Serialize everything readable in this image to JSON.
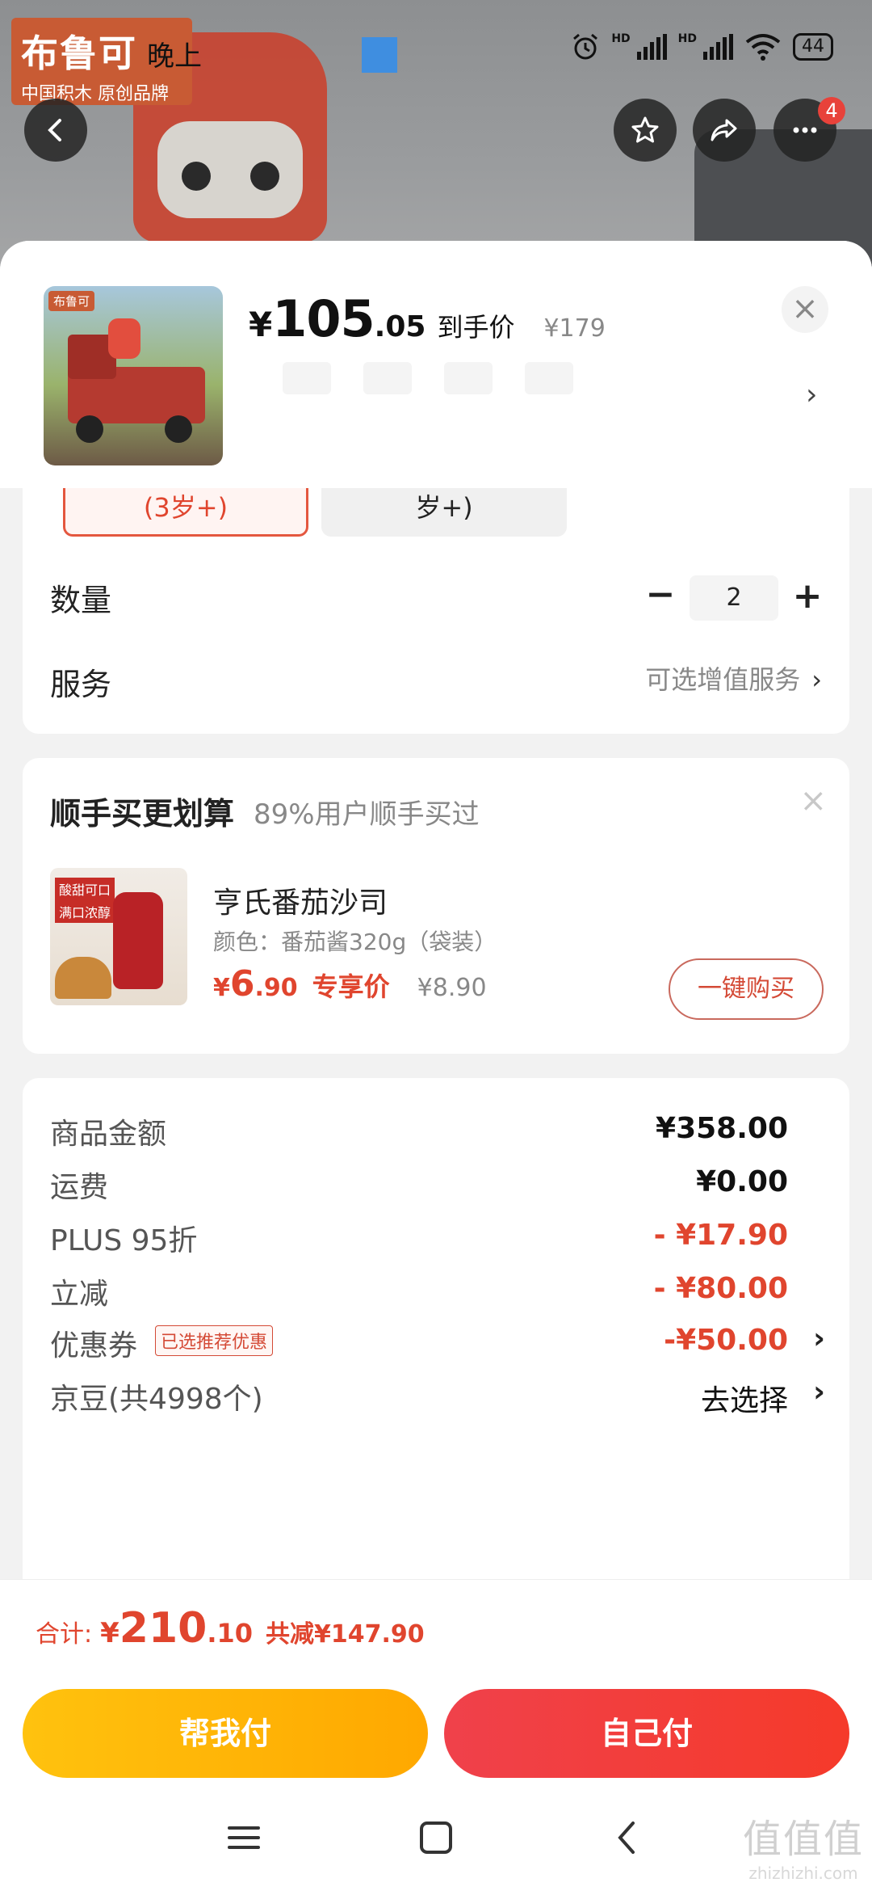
{
  "status_bar": {
    "time": "晚上",
    "battery": "44"
  },
  "backdrop": {
    "logo_big": "布鲁可",
    "logo_small": "中国积木 原创品牌"
  },
  "nav": {
    "badge": "4"
  },
  "product": {
    "price_symbol": "¥",
    "price_int": "105",
    "price_dec": ".05",
    "price_tag": "到手价",
    "original_price": "¥179",
    "thumb_brand": "布鲁可"
  },
  "spec": {
    "option_selected": "(3岁+)",
    "option_other": "岁+)"
  },
  "quantity": {
    "label": "数量",
    "minus": "−",
    "value": "2",
    "plus": "+"
  },
  "service": {
    "label": "服务",
    "value": "可选增值服务"
  },
  "addon": {
    "title": "顺手买更划算",
    "subtitle": "89%用户顺手买过",
    "close": "×",
    "image_tags": [
      "酸甜可口",
      "满口浓醇"
    ],
    "name": "亨氏番茄沙司",
    "spec": "颜色：番茄酱320g（袋装）",
    "price_symbol": "¥",
    "price_int": "6",
    "price_dec": ".90",
    "price_tag": "专享价",
    "original_price": "¥8.90",
    "buy_label": "一键购买"
  },
  "summary": [
    {
      "label": "商品金额",
      "value": "¥358.00"
    },
    {
      "label": "运费",
      "value": "¥0.00"
    },
    {
      "label": "PLUS 95折",
      "value": "- ¥17.90"
    },
    {
      "label": "立减",
      "value": "- ¥80.00"
    },
    {
      "label": "优惠券",
      "tag": "已选推荐优惠",
      "value": "-¥50.00"
    },
    {
      "label": "京豆(共4998个)",
      "value": "去选择"
    }
  ],
  "total": {
    "label": "合计:",
    "symbol": "¥",
    "int": "210",
    "dec": ".10",
    "saved": "共减¥147.90"
  },
  "actions": {
    "help_pay": "帮我付",
    "self_pay": "自己付"
  },
  "watermark": {
    "big": "值值值",
    "small": "zhizhizhi.com"
  },
  "colors": {
    "accent_red": "#e0452e",
    "yellow": "#ffb300",
    "pay_red": "#f23c3a"
  }
}
